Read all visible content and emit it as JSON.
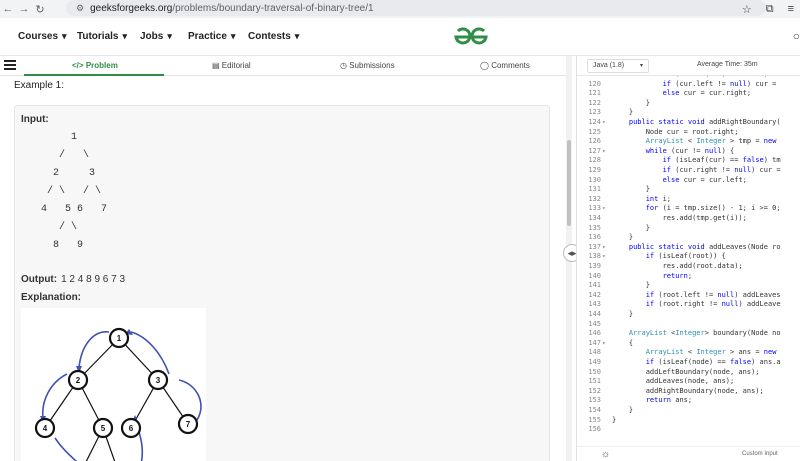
{
  "browser": {
    "url_host": "geeksforgeeks.org",
    "url_path": "/problems/boundary-traversal-of-binary-tree/1"
  },
  "site_nav": {
    "items": [
      "Courses",
      "Tutorials",
      "Jobs",
      "Practice",
      "Contests"
    ],
    "logo_text": "GfG"
  },
  "tabs": [
    {
      "label": "Problem",
      "icon": "code-icon",
      "active": true
    },
    {
      "label": "Editorial",
      "icon": "document-icon",
      "active": false
    },
    {
      "label": "Submissions",
      "icon": "clock-icon",
      "active": false
    },
    {
      "label": "Comments",
      "icon": "chat-icon",
      "active": false
    }
  ],
  "problem": {
    "example_heading": "Example 1:",
    "input_label": "Input:",
    "tree_lines": [
      "        1",
      "      /   \\",
      "     2     3",
      "    / \\   / \\",
      "   4   5 6   7",
      "      / \\",
      "     8   9"
    ],
    "output_label": "Output:",
    "output_value": "1 2 4 8 9 6 7 3",
    "explanation_label": "Explanation:",
    "tree_nodes": [
      "1",
      "2",
      "3",
      "4",
      "5",
      "6",
      "7",
      "8",
      "9"
    ]
  },
  "editor": {
    "language": "Java (1.8)",
    "avg_time": "Average Time: 35m",
    "lines": [
      {
        "n": "119",
        "fold": false,
        "text": "            if (isLeaf(cur) == false) r"
      },
      {
        "n": "120",
        "fold": false,
        "text": "            if (cur.left != null) cur = "
      },
      {
        "n": "121",
        "fold": false,
        "text": "            else cur = cur.right;"
      },
      {
        "n": "122",
        "fold": false,
        "text": "        }"
      },
      {
        "n": "123",
        "fold": false,
        "text": "    }"
      },
      {
        "n": "124",
        "fold": true,
        "text": "    public static void addRightBoundary("
      },
      {
        "n": "125",
        "fold": false,
        "text": "        Node cur = root.right;"
      },
      {
        "n": "126",
        "fold": false,
        "text": "        ArrayList < Integer > tmp = new"
      },
      {
        "n": "127",
        "fold": true,
        "text": "        while (cur != null) {"
      },
      {
        "n": "128",
        "fold": false,
        "text": "            if (isLeaf(cur) == false) tm"
      },
      {
        "n": "129",
        "fold": false,
        "text": "            if (cur.right != null) cur ="
      },
      {
        "n": "130",
        "fold": false,
        "text": "            else cur = cur.left;"
      },
      {
        "n": "131",
        "fold": false,
        "text": "        }"
      },
      {
        "n": "132",
        "fold": false,
        "text": "        int i;"
      },
      {
        "n": "133",
        "fold": true,
        "text": "        for (i = tmp.size() - 1; i >= 0;"
      },
      {
        "n": "134",
        "fold": false,
        "text": "            res.add(tmp.get(i));"
      },
      {
        "n": "135",
        "fold": false,
        "text": "        }"
      },
      {
        "n": "136",
        "fold": false,
        "text": "    }"
      },
      {
        "n": "137",
        "fold": true,
        "text": "    public static void addLeaves(Node ro"
      },
      {
        "n": "138",
        "fold": true,
        "text": "        if (isLeaf(root)) {"
      },
      {
        "n": "139",
        "fold": false,
        "text": "            res.add(root.data);"
      },
      {
        "n": "140",
        "fold": false,
        "text": "            return;"
      },
      {
        "n": "141",
        "fold": false,
        "text": "        }"
      },
      {
        "n": "142",
        "fold": false,
        "text": "        if (root.left != null) addLeaves"
      },
      {
        "n": "143",
        "fold": false,
        "text": "        if (root.right != null) addLeave"
      },
      {
        "n": "144",
        "fold": false,
        "text": "    }"
      },
      {
        "n": "145",
        "fold": false,
        "text": ""
      },
      {
        "n": "146",
        "fold": false,
        "text": "    ArrayList <Integer> boundary(Node no"
      },
      {
        "n": "147",
        "fold": true,
        "text": "    {"
      },
      {
        "n": "148",
        "fold": false,
        "text": "        ArrayList < Integer > ans = new"
      },
      {
        "n": "149",
        "fold": false,
        "text": "        if (isLeaf(node) == false) ans.a"
      },
      {
        "n": "150",
        "fold": false,
        "text": "        addLeftBoundary(node, ans);"
      },
      {
        "n": "151",
        "fold": false,
        "text": "        addLeaves(node, ans);"
      },
      {
        "n": "152",
        "fold": false,
        "text": "        addRightBoundary(node, ans);"
      },
      {
        "n": "153",
        "fold": false,
        "text": "        return ans;"
      },
      {
        "n": "154",
        "fold": false,
        "text": "    }"
      },
      {
        "n": "155",
        "fold": false,
        "text": "}"
      },
      {
        "n": "156",
        "fold": false,
        "text": ""
      }
    ],
    "custom_input_label": "Custom Input"
  },
  "colors": {
    "brand": "#2f8d46",
    "boundary_arrow": "#3f51b5"
  }
}
